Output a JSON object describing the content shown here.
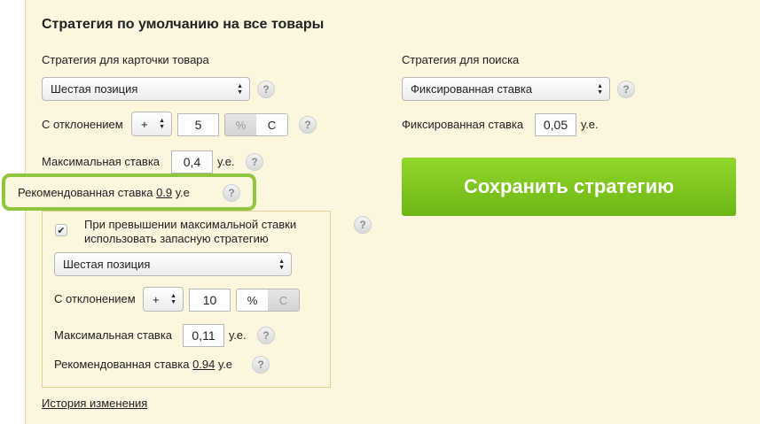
{
  "strategy": {
    "title": "Стратегия по умолчанию на все товары",
    "card": {
      "label": "Стратегия для карточки товара",
      "select_value": "Шестая позиция",
      "deviation_label": "С отклонением",
      "sign": "+",
      "deviation_value": "5",
      "unit_percent": "%",
      "unit_c": "С",
      "max_bid_label": "Максимальная ставка",
      "max_bid_value": "0,4",
      "currency": "у.е.",
      "rec_bid_label": "Рекомендованная ставка",
      "rec_bid_value": "0.9",
      "rec_bid_unit": "у.е"
    },
    "search": {
      "label": "Стратегия для поиска",
      "select_value": "Фиксированная ставка",
      "fixed_label": "Фиксированная ставка",
      "fixed_value": "0,05",
      "currency": "у.е."
    },
    "fallback": {
      "checkbox_checked": true,
      "checkbox_label_line1": "При превышении максимальной ставки",
      "checkbox_label_line2": "использовать запасную стратегию",
      "select_value": "Шестая позиция",
      "deviation_label": "С отклонением",
      "sign": "+",
      "deviation_value": "10",
      "unit_percent": "%",
      "unit_c": "С",
      "max_bid_label": "Максимальная ставка",
      "max_bid_value": "0,11",
      "currency": "у.е.",
      "rec_bid_label": "Рекомендованная ставка",
      "rec_bid_value": "0.94",
      "rec_bid_unit": "у.е"
    },
    "save_button": "Сохранить стратегию",
    "history_link": "История изменения",
    "help_glyph": "?",
    "check_glyph": "✔",
    "colors": {
      "accent_green": "#7cc41f",
      "panel_bg": "#fdf6de",
      "highlight_border": "#8ec63f"
    },
    "icons": {
      "help": "question-circle-icon",
      "select": "up-down-arrows-icon",
      "checkbox": "checkmark-icon"
    }
  }
}
